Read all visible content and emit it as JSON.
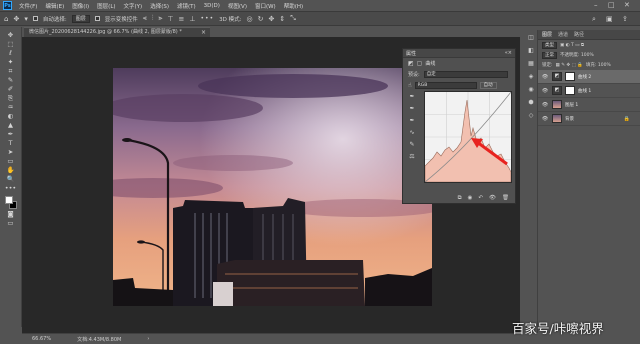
{
  "menubar": {
    "logo": "Ps",
    "items": [
      "文件(F)",
      "编辑(E)",
      "图像(I)",
      "图层(L)",
      "文字(Y)",
      "选择(S)",
      "滤镜(T)",
      "3D(D)",
      "视图(V)",
      "窗口(W)",
      "帮助(H)"
    ],
    "window_controls": [
      "–",
      "□",
      "✕"
    ]
  },
  "options_bar": {
    "auto_select_label": "自动选择:",
    "auto_select_value": "图层",
    "transform_label": "显示变换控件",
    "more": "•••",
    "mode_3d_label": "3D 模式:"
  },
  "toolbar": {
    "tools": [
      "✥",
      "⬚",
      "ℓ",
      "✦",
      "⌗",
      "✎",
      "✐",
      "⎘",
      "♒",
      "◐",
      "▲",
      "✒",
      "T",
      "➤",
      "▭",
      "✋",
      "🔍",
      "•••"
    ]
  },
  "document": {
    "tab_title": "微信图片_20200628144226.jpg @ 66.7% (曲线 2, 图层蒙版/8) *",
    "close": "×",
    "zoom": "66.67%",
    "doc_size": "文档:4.43M/8.80M"
  },
  "properties_panel": {
    "title": "属性",
    "close": "«×",
    "adjustment_name": "曲线",
    "preset_label": "预设:",
    "preset_value": "自定",
    "channel_value": "RGB",
    "auto_button": "自动",
    "curve_tools": [
      "☝",
      "✒",
      "✒",
      "✒",
      "∿",
      "✎",
      "⚖"
    ],
    "bottom_icons": [
      "⧉",
      "◉",
      "↶",
      "👁",
      "🗑"
    ]
  },
  "dock": {
    "icons": [
      "◫",
      "◧",
      "▦",
      "◈",
      "◉",
      "⬢",
      "◇"
    ]
  },
  "layers_panel": {
    "tabs": [
      "图层",
      "通道",
      "路径"
    ],
    "kind_label": "类型",
    "blend_mode": "正常",
    "opacity_label": "不透明度: 100%",
    "lock_label": "锁定:",
    "fill_label": "填充: 100%",
    "layers": [
      {
        "name": "曲线 2",
        "type": "adjustment",
        "selected": true
      },
      {
        "name": "曲线 1",
        "type": "adjustment",
        "selected": false
      },
      {
        "name": "图层 1",
        "type": "image",
        "selected": false
      },
      {
        "name": "背景",
        "type": "image",
        "selected": false
      }
    ],
    "lock_icon": "🔒"
  },
  "histogram": {
    "accent_arrow": "#e8231f",
    "graph_bg": "#f2f2f2"
  },
  "watermark": "百家号/咔嚓视界"
}
